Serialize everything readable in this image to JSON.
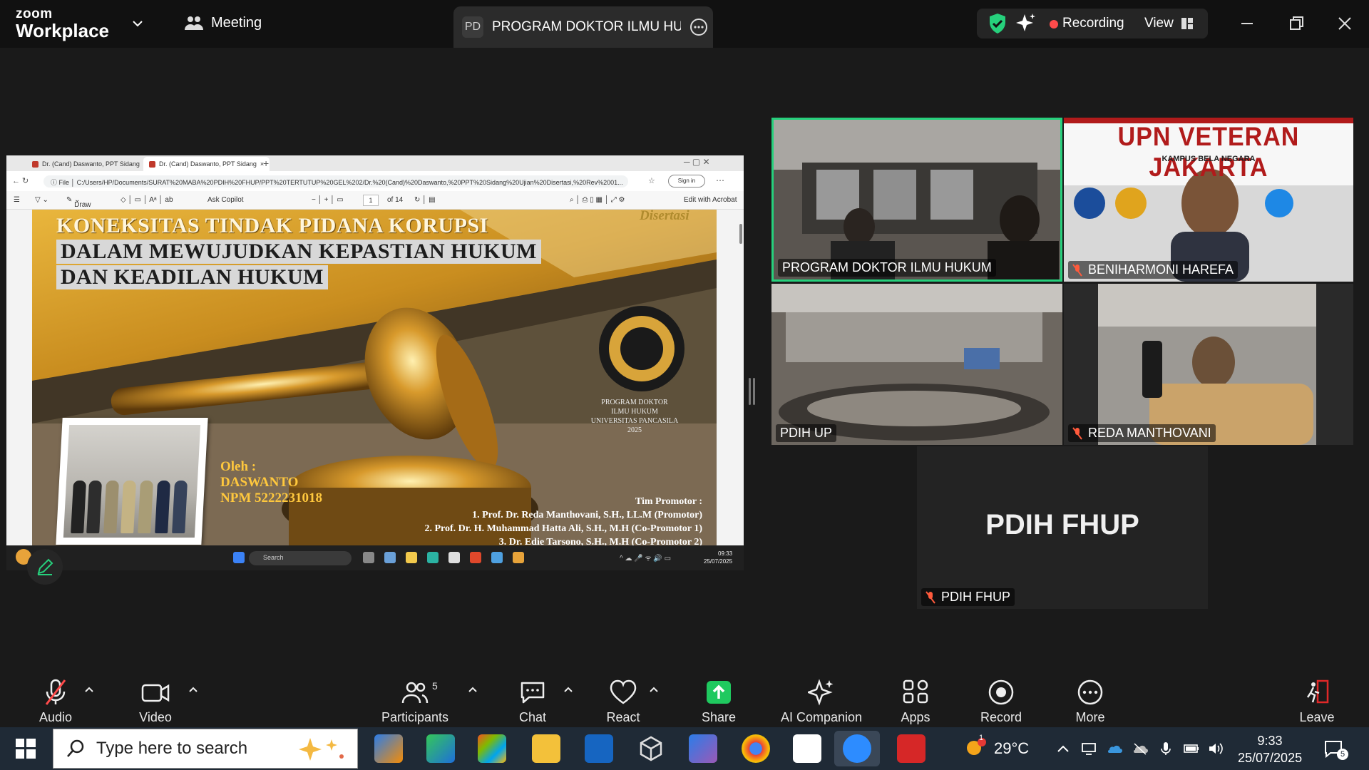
{
  "app": {
    "brand_top": "zoom",
    "brand_bottom": "Workplace",
    "meeting_label": "Meeting",
    "tab_badge": "PD",
    "tab_title": "PROGRAM DOKTOR ILMU HUKUM",
    "recording_label": "Recording",
    "view_label": "View"
  },
  "shared_screen": {
    "browser_tabs": [
      "Dr. (Cand) Daswanto, PPT Sidang",
      "Dr. (Cand) Daswanto, PPT Sidang"
    ],
    "url_prefix": "File",
    "url": "C:/Users/HP/Documents/SURAT%20MABA%20PDIH%20FHUP/PPT%20TERTUTUP%20GEL%202/Dr.%20(Cand)%20Daswanto,%20PPT%20Sidang%20Ujian%20Disertasi,%20Rev%2001...",
    "sign_in": "Sign in",
    "pdf_toolbar": {
      "draw": "Draw",
      "ask_copilot": "Ask Copilot",
      "page_current": "1",
      "page_total": "of 14",
      "edit_acrobat": "Edit with Acrobat"
    },
    "slide": {
      "tag": "Disertasi",
      "title_line1": "KONEKSITAS TINDAK PIDANA KORUPSI",
      "title_line2": "DALAM MEWUJUDKAN KEPASTIAN HUKUM",
      "title_line3": "DAN KEADILAN HUKUM",
      "oleh": "Oleh :",
      "name": "DASWANTO",
      "npm": "NPM 5222231018",
      "program_line1": "PROGRAM DOKTOR",
      "program_line2": "ILMU HUKUM",
      "program_line3": "UNIVERSITAS PANCASILA",
      "program_year": "2025",
      "promotor_title": "Tim Promotor :",
      "promotor_1": "1.    Prof. Dr. Reda Manthovani, S.H., LL.M (Promotor)",
      "promotor_2": "2.    Prof. Dr. H. Muhammad Hatta Ali, S.H., M.H (Co-Promotor 1)",
      "promotor_3": "3.    Dr. Edie Tarsono, S.H., M.H (Co-Promotor 2)"
    },
    "inner_taskbar": {
      "search": "Search",
      "time": "09:33",
      "date": "25/07/2025"
    }
  },
  "participants": [
    {
      "name": "PROGRAM DOKTOR ILMU HUKUM",
      "muted": false,
      "active": true
    },
    {
      "name": "BENIHARMONI HAREFA",
      "muted": true,
      "active": false
    },
    {
      "name": "PDIH UP",
      "muted": false,
      "active": false
    },
    {
      "name": "REDA MANTHOVANI",
      "muted": true,
      "active": false
    },
    {
      "name": "PDIH FHUP",
      "muted": true,
      "active": false
    }
  ],
  "tiles": {
    "upn_title": "UPN VETERAN JAKARTA",
    "upn_subtitle": "KAMPUS BELA NEGARA",
    "pdih_fhup_display": "PDIH FHUP"
  },
  "toolbar": {
    "audio": "Audio",
    "video": "Video",
    "participants": "Participants",
    "participants_count": "5",
    "chat": "Chat",
    "react": "React",
    "share": "Share",
    "ai_companion": "AI Companion",
    "apps": "Apps",
    "record": "Record",
    "more": "More",
    "leave": "Leave"
  },
  "taskbar": {
    "search_placeholder": "Type here to search",
    "temperature": "29°C",
    "weather_badge": "1",
    "time": "9:33",
    "date": "25/07/2025",
    "notifications": "5"
  },
  "colors": {
    "accent_green": "#26d07c",
    "share_green": "#1fc95f",
    "recording_red": "#ff4b4b",
    "leave_red": "#e02828"
  }
}
